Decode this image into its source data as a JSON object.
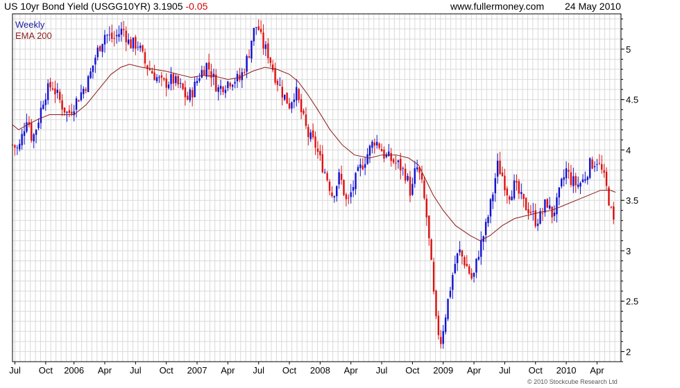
{
  "header": {
    "instrument": "US 10yr Bond Yield (USGG10YR)",
    "last": "3.1905",
    "change": "-0.05",
    "site": "www.fullermoney.com",
    "date": "24 May 2010"
  },
  "footer": {
    "copyright": "© 2010 Stockcube Research Ltd"
  },
  "colors": {
    "up": "#1010d0",
    "down": "#e01010",
    "ema": "#8b1a1a",
    "grid": "#d9d9d9",
    "legend_weekly": "#1a1aa0",
    "legend_ema": "#8b1a1a"
  },
  "chart_data": {
    "type": "candlestick",
    "legend": [
      "Weekly",
      "EMA 200"
    ],
    "y_axis": {
      "side": "right",
      "ylim": [
        1.9,
        5.35
      ],
      "ticks": [
        2,
        2.5,
        3,
        3.5,
        4,
        4.5,
        5
      ],
      "tick_labels": [
        "2",
        "2.5",
        "3",
        "3.5",
        "4",
        "4.5",
        "5"
      ]
    },
    "x_axis": {
      "xlim": [
        2005.5,
        2010.445
      ],
      "ticks": [
        2005.52,
        2005.77,
        2006.0,
        2006.25,
        2006.5,
        2006.75,
        2007.0,
        2007.25,
        2007.5,
        2007.75,
        2008.0,
        2008.25,
        2008.5,
        2008.75,
        2009.0,
        2009.25,
        2009.5,
        2009.75,
        2010.0,
        2010.25
      ],
      "tick_labels": [
        "Jul",
        "Oct",
        "2006",
        "Apr",
        "Jul",
        "Oct",
        "2007",
        "Apr",
        "Jul",
        "Oct",
        "2008",
        "Apr",
        "Jul",
        "Oct",
        "2009",
        "Apr",
        "Jul",
        "Oct",
        "2010",
        "Apr"
      ]
    },
    "price_path": [
      [
        2005.5,
        4.05
      ],
      [
        2005.55,
        4.0
      ],
      [
        2005.62,
        4.35
      ],
      [
        2005.66,
        4.1
      ],
      [
        2005.7,
        4.25
      ],
      [
        2005.76,
        4.55
      ],
      [
        2005.82,
        4.65
      ],
      [
        2005.9,
        4.45
      ],
      [
        2005.95,
        4.35
      ],
      [
        2006.0,
        4.45
      ],
      [
        2006.05,
        4.55
      ],
      [
        2006.12,
        4.7
      ],
      [
        2006.18,
        4.95
      ],
      [
        2006.25,
        5.15
      ],
      [
        2006.32,
        5.1
      ],
      [
        2006.4,
        5.2
      ],
      [
        2006.45,
        5.05
      ],
      [
        2006.52,
        5.05
      ],
      [
        2006.58,
        4.85
      ],
      [
        2006.65,
        4.75
      ],
      [
        2006.72,
        4.65
      ],
      [
        2006.8,
        4.7
      ],
      [
        2006.88,
        4.6
      ],
      [
        2006.92,
        4.5
      ],
      [
        2006.97,
        4.6
      ],
      [
        2007.02,
        4.75
      ],
      [
        2007.08,
        4.85
      ],
      [
        2007.12,
        4.75
      ],
      [
        2007.17,
        4.6
      ],
      [
        2007.22,
        4.65
      ],
      [
        2007.28,
        4.7
      ],
      [
        2007.35,
        4.7
      ],
      [
        2007.42,
        4.95
      ],
      [
        2007.45,
        5.15
      ],
      [
        2007.49,
        5.25
      ],
      [
        2007.53,
        5.05
      ],
      [
        2007.58,
        4.95
      ],
      [
        2007.63,
        4.75
      ],
      [
        2007.7,
        4.55
      ],
      [
        2007.75,
        4.45
      ],
      [
        2007.8,
        4.6
      ],
      [
        2007.84,
        4.4
      ],
      [
        2007.9,
        4.15
      ],
      [
        2007.96,
        4.05
      ],
      [
        2008.0,
        3.9
      ],
      [
        2008.05,
        3.75
      ],
      [
        2008.1,
        3.55
      ],
      [
        2008.16,
        3.75
      ],
      [
        2008.22,
        3.45
      ],
      [
        2008.27,
        3.65
      ],
      [
        2008.32,
        3.8
      ],
      [
        2008.38,
        3.95
      ],
      [
        2008.44,
        4.1
      ],
      [
        2008.48,
        4.05
      ],
      [
        2008.52,
        3.95
      ],
      [
        2008.58,
        3.9
      ],
      [
        2008.64,
        3.85
      ],
      [
        2008.7,
        3.75
      ],
      [
        2008.74,
        3.55
      ],
      [
        2008.78,
        3.85
      ],
      [
        2008.82,
        3.7
      ],
      [
        2008.86,
        3.4
      ],
      [
        2008.9,
        2.9
      ],
      [
        2008.94,
        2.3
      ],
      [
        2008.98,
        2.1
      ],
      [
        2009.03,
        2.45
      ],
      [
        2009.09,
        2.85
      ],
      [
        2009.13,
        3.0
      ],
      [
        2009.19,
        2.85
      ],
      [
        2009.24,
        2.7
      ],
      [
        2009.29,
        3.0
      ],
      [
        2009.35,
        3.25
      ],
      [
        2009.4,
        3.55
      ],
      [
        2009.44,
        3.85
      ],
      [
        2009.48,
        3.75
      ],
      [
        2009.53,
        3.55
      ],
      [
        2009.58,
        3.65
      ],
      [
        2009.62,
        3.55
      ],
      [
        2009.66,
        3.45
      ],
      [
        2009.71,
        3.4
      ],
      [
        2009.75,
        3.3
      ],
      [
        2009.8,
        3.35
      ],
      [
        2009.84,
        3.5
      ],
      [
        2009.88,
        3.35
      ],
      [
        2009.92,
        3.45
      ],
      [
        2009.96,
        3.65
      ],
      [
        2010.0,
        3.8
      ],
      [
        2010.04,
        3.7
      ],
      [
        2010.09,
        3.65
      ],
      [
        2010.14,
        3.7
      ],
      [
        2010.19,
        3.85
      ],
      [
        2010.25,
        3.9
      ],
      [
        2010.3,
        3.75
      ],
      [
        2010.34,
        3.55
      ],
      [
        2010.37,
        3.35
      ],
      [
        2010.4,
        3.19
      ]
    ],
    "ema200": [
      [
        2005.5,
        4.25
      ],
      [
        2005.55,
        4.2
      ],
      [
        2005.62,
        4.25
      ],
      [
        2005.7,
        4.3
      ],
      [
        2005.8,
        4.35
      ],
      [
        2005.9,
        4.35
      ],
      [
        2006.0,
        4.35
      ],
      [
        2006.1,
        4.45
      ],
      [
        2006.2,
        4.6
      ],
      [
        2006.3,
        4.75
      ],
      [
        2006.38,
        4.82
      ],
      [
        2006.45,
        4.85
      ],
      [
        2006.55,
        4.82
      ],
      [
        2006.65,
        4.8
      ],
      [
        2006.75,
        4.78
      ],
      [
        2006.85,
        4.75
      ],
      [
        2006.95,
        4.72
      ],
      [
        2007.05,
        4.74
      ],
      [
        2007.15,
        4.73
      ],
      [
        2007.25,
        4.7
      ],
      [
        2007.35,
        4.72
      ],
      [
        2007.45,
        4.78
      ],
      [
        2007.55,
        4.82
      ],
      [
        2007.65,
        4.8
      ],
      [
        2007.75,
        4.75
      ],
      [
        2007.82,
        4.68
      ],
      [
        2007.9,
        4.55
      ],
      [
        2007.98,
        4.4
      ],
      [
        2008.08,
        4.2
      ],
      [
        2008.18,
        4.05
      ],
      [
        2008.28,
        3.95
      ],
      [
        2008.4,
        3.92
      ],
      [
        2008.5,
        3.95
      ],
      [
        2008.62,
        3.95
      ],
      [
        2008.72,
        3.92
      ],
      [
        2008.8,
        3.85
      ],
      [
        2008.86,
        3.7
      ],
      [
        2008.92,
        3.55
      ],
      [
        2009.0,
        3.4
      ],
      [
        2009.1,
        3.25
      ],
      [
        2009.22,
        3.15
      ],
      [
        2009.3,
        3.1
      ],
      [
        2009.38,
        3.15
      ],
      [
        2009.48,
        3.25
      ],
      [
        2009.58,
        3.32
      ],
      [
        2009.68,
        3.35
      ],
      [
        2009.78,
        3.38
      ],
      [
        2009.88,
        3.4
      ],
      [
        2009.98,
        3.45
      ],
      [
        2010.08,
        3.5
      ],
      [
        2010.18,
        3.55
      ],
      [
        2010.28,
        3.6
      ],
      [
        2010.36,
        3.6
      ],
      [
        2010.4,
        3.58
      ]
    ]
  }
}
